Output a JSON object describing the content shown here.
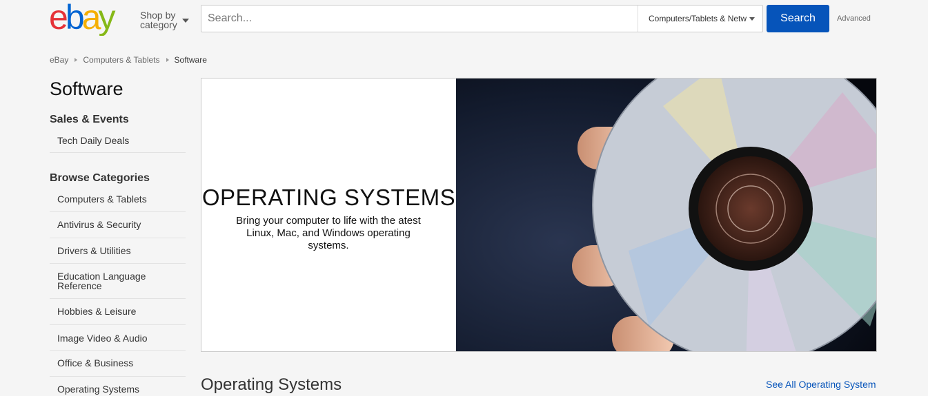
{
  "header": {
    "logo_text": "ebay",
    "shop_by_line1": "Shop by",
    "shop_by_line2": "category",
    "search_placeholder": "Search...",
    "category_selected": "Computers/Tablets & Netw",
    "search_button": "Search",
    "advanced_link": "Advanced"
  },
  "breadcrumb": [
    "eBay",
    "Computers & Tablets",
    "Software"
  ],
  "sidebar": {
    "title": "Software",
    "sales_heading": "Sales & Events",
    "sales_items": [
      "Tech Daily Deals"
    ],
    "browse_heading": "Browse Categories",
    "browse_items": [
      "Computers & Tablets",
      "Antivirus & Security",
      "Drivers & Utilities",
      "Education Language Reference",
      "Hobbies & Leisure",
      "Image Video & Audio",
      "Office & Business",
      "Operating Systems"
    ]
  },
  "banner": {
    "title": "OPERATING SYSTEMS",
    "subtitle": "Bring your computer to life with the atest Linux, Mac, and Windows operating systems."
  },
  "section": {
    "title": "Operating Systems",
    "see_all": "See All Operating System"
  },
  "colors": {
    "ebay_e": "#e53238",
    "ebay_b": "#0064d2",
    "ebay_a": "#f5af02",
    "ebay_y": "#86b817",
    "search_button": "#0654ba",
    "link": "#0654ba"
  }
}
